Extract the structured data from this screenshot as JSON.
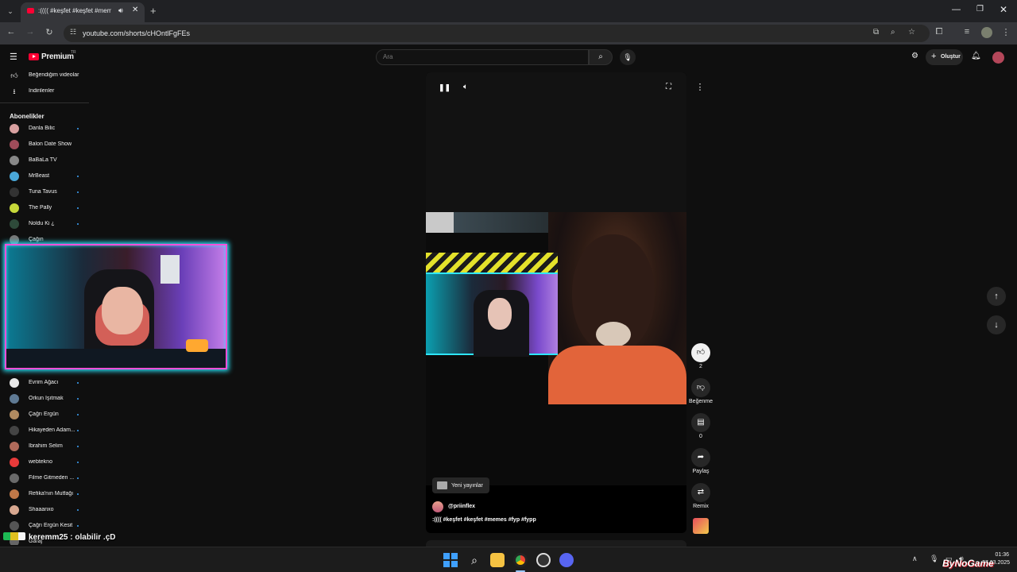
{
  "browser": {
    "tab_title": ":(((( #keşfet #keşfet #memes",
    "url": "youtube.com/shorts/cHOntlFgFEs",
    "icons": [
      "tab-list-icon",
      "audio-icon",
      "close-icon",
      "plus-icon",
      "back-icon",
      "forward-icon",
      "reload-icon",
      "site-info-icon",
      "install-icon",
      "zoom-icon",
      "star-icon",
      "extensions-icon",
      "media-icon"
    ]
  },
  "youtube": {
    "logo_text": "Premium",
    "country_code": "TR",
    "search_placeholder": "Ara",
    "create_label": "Oluştur",
    "sidebar_top": [
      {
        "label": "Beğendiğim videolar",
        "icon": "thumbs-up-icon"
      },
      {
        "label": "İndirilenler",
        "icon": "download-icon"
      }
    ],
    "subscriptions_title": "Abonelikler",
    "subscriptions_top": [
      {
        "label": "Danla Bilic"
      },
      {
        "label": "Balon Date Show"
      },
      {
        "label": "BaBaLa TV"
      },
      {
        "label": "MrBeast"
      },
      {
        "label": "Tuna Tavus"
      },
      {
        "label": "The Pally"
      },
      {
        "label": "Noldu Ki ¿"
      },
      {
        "label": "Çağın"
      }
    ],
    "subscriptions_bottom": [
      {
        "label": "Evrim Ağacı"
      },
      {
        "label": "Orkun Işıtmak"
      },
      {
        "label": "Çağrı Ergün"
      },
      {
        "label": "Hikayeden Adam..."
      },
      {
        "label": "İbrahim Selim"
      },
      {
        "label": "webtekno"
      },
      {
        "label": "Filme Gitmeden ..."
      },
      {
        "label": "Refika'nın Mutfağı"
      },
      {
        "label": "Shaaanxo"
      },
      {
        "label": "Çağrı Ergün Kesit"
      },
      {
        "label": "Garaj"
      }
    ]
  },
  "short": {
    "chip_label": "Yeni yayınlar",
    "channel": "@priinflex",
    "title": ":(((( #keşfet #keşfet #memes  #fyp #fypp",
    "like_count": "2",
    "dislike_label": "Beğenme",
    "comment_count": "0",
    "share_label": "Paylaş",
    "remix_label": "Remix"
  },
  "overlay": {
    "chat_user": "keremm25",
    "chat_message": ": olabilir .çD",
    "watermark": "ByNoGame"
  },
  "taskbar": {
    "time": "01:36",
    "date": "27.03.2025",
    "apps": [
      "start-icon",
      "search-icon",
      "file-explorer-icon",
      "chrome-icon",
      "app-icon",
      "discord-icon"
    ]
  },
  "colors": {
    "yt_red": "#ff0033",
    "webcam_border": "#ff4fd8",
    "webcam_glow": "#2ee6ff",
    "link_blue": "#3ea6ff"
  }
}
